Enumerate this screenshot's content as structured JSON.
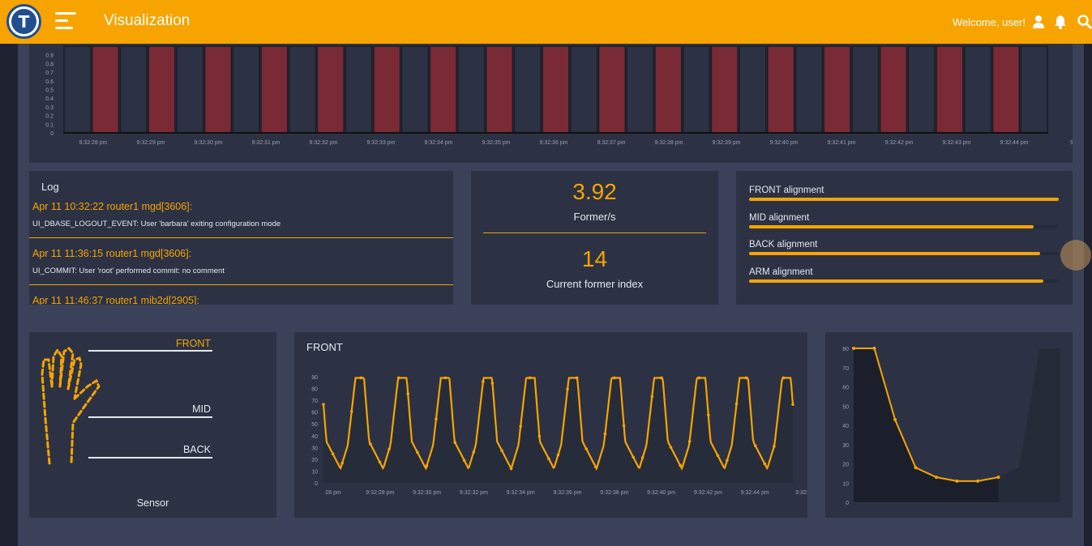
{
  "header": {
    "title": "Visualization",
    "logo_letter": "T",
    "welcome": "Welcome, user!",
    "icons": [
      "user-icon",
      "bell-icon",
      "search-icon"
    ],
    "accent_color": "#f7a400"
  },
  "log": {
    "title": "Log",
    "entries": [
      {
        "head": "Apr 11 10:32:22 router1 mgd[3606]:",
        "msg": "UI_DBASE_LOGOUT_EVENT: User 'barbara' exiting configuration mode"
      },
      {
        "head": "Apr 11 11:36:15 router1 mgd[3606]:",
        "msg": "UI_COMMIT: User 'root' performed commit: no comment"
      },
      {
        "head": "Apr 11 11:46:37 router1 mib2d[2905]:",
        "msg": ""
      }
    ]
  },
  "metrics": {
    "formers_value": "3.92",
    "formers_label": "Former/s",
    "index_value": "14",
    "index_label": "Current former index"
  },
  "alignment": [
    {
      "label": "FRONT alignment",
      "value": 1.0
    },
    {
      "label": "MID alignment",
      "value": 0.92
    },
    {
      "label": "BACK alignment",
      "value": 0.94
    },
    {
      "label": "ARM alignment",
      "value": 0.95
    }
  ],
  "sensor": {
    "title": "Sensor",
    "front_label": "FRONT",
    "mid_label": "MID",
    "back_label": "BACK"
  },
  "chart_data": [
    {
      "type": "bar",
      "title": "",
      "yticks": [
        "0",
        "0.1",
        "0.2",
        "0.3",
        "0.4",
        "0.5",
        "0.6",
        "0.7",
        "0.8",
        "0.9"
      ],
      "ylim": [
        0,
        1
      ],
      "xticks": [
        "9:32:28 pm",
        "9:32:29 pm",
        "9:32:30 pm",
        "9:32:31 pm",
        "9:32:32 pm",
        "9:32:33 pm",
        "9:32:34 pm",
        "9:32:35 pm",
        "9:32:36 pm",
        "9:32:37 pm",
        "9:32:38 pm",
        "9:32:39 pm",
        "9:32:40 pm",
        "9:32:41 pm",
        "9:32:42 pm",
        "9:32:43 pm",
        "9:32:44 pm",
        "9"
      ],
      "values": [
        1,
        1,
        1,
        1,
        1,
        1,
        1,
        1,
        1,
        1,
        1,
        1,
        1,
        1,
        1,
        1,
        1,
        1,
        1,
        1,
        1,
        1,
        1,
        1,
        1,
        1,
        1,
        1,
        1,
        1,
        1,
        1,
        1,
        1,
        1
      ],
      "colors": [
        "#2c3244",
        "#7a2a35"
      ]
    },
    {
      "type": "line",
      "title": "FRONT",
      "yticks": [
        "0",
        "10",
        "20",
        "30",
        "40",
        "50",
        "60",
        "70",
        "80",
        "90"
      ],
      "ylim": [
        0,
        90
      ],
      "xticks": [
        "28 pm",
        "9:32:28 pm",
        "9:32:30 pm",
        "9:32:32 pm",
        "9:32:34 pm",
        "9:32:36 pm",
        "9:32:38 pm",
        "9:32:40 pm",
        "9:32:42 pm",
        "9:32:44 pm",
        "9:32:"
      ],
      "cycles": 11,
      "min_value": 12,
      "max_value": 89,
      "color": "#f7a400"
    },
    {
      "type": "area",
      "title": "",
      "yticks": [
        "0",
        "10",
        "20",
        "30",
        "40",
        "50",
        "60",
        "70",
        "80"
      ],
      "ylim": [
        0,
        80
      ],
      "x": [
        0,
        1,
        2,
        3,
        4,
        5,
        6,
        7,
        8,
        9,
        10
      ],
      "values": [
        80,
        80,
        43,
        18,
        13,
        11,
        11,
        13,
        18,
        80,
        80
      ],
      "highlight_range": [
        0,
        7
      ],
      "color": "#f7a400"
    }
  ]
}
